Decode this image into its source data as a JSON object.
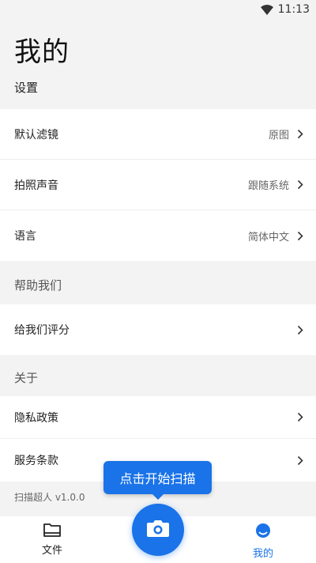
{
  "status_bar": {
    "time": "11:13"
  },
  "page": {
    "title": "我的"
  },
  "settings": {
    "header": "设置",
    "items": [
      {
        "label": "默认滤镜",
        "value": "原图"
      },
      {
        "label": "拍照声音",
        "value": "跟随系统"
      },
      {
        "label": "语言",
        "value": "简体中文"
      }
    ]
  },
  "help": {
    "header": "帮助我们",
    "items": [
      {
        "label": "给我们评分"
      }
    ]
  },
  "about": {
    "header": "关于",
    "items": [
      {
        "label": "隐私政策"
      },
      {
        "label": "服务条款"
      }
    ]
  },
  "version": "扫描超人 v1.0.0",
  "tooltip": "点击开始扫描",
  "tabs": {
    "files_label": "文件",
    "mine_label": "我的"
  },
  "colors": {
    "accent": "#1a73e8",
    "background": "#f3f3f3"
  },
  "icons": [
    "wifi-icon",
    "chevron-right-icon",
    "folder-icon",
    "camera-icon",
    "profile-icon"
  ]
}
